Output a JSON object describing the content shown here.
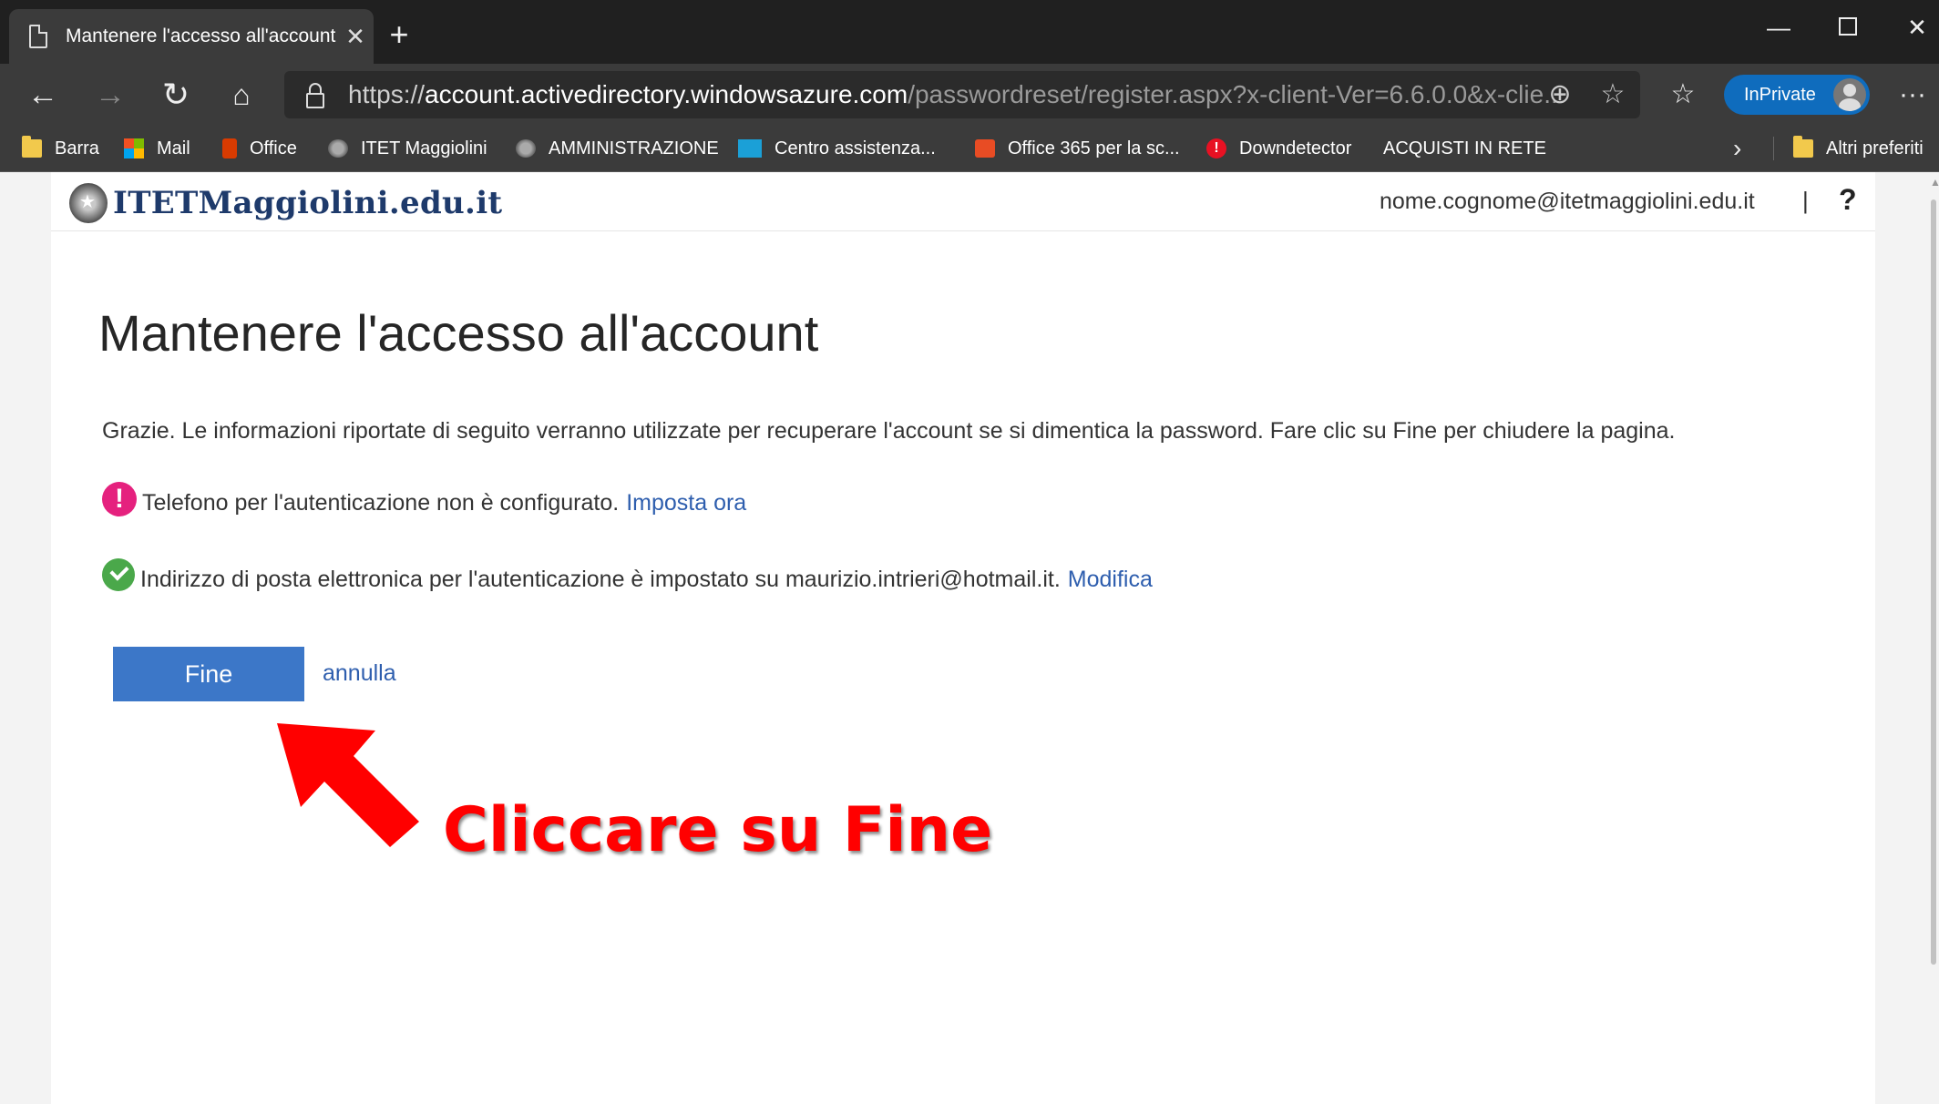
{
  "browser": {
    "tab_title": "Mantenere l'accesso all'account",
    "tab_close": "✕",
    "new_tab": "+",
    "url_scheme": "https://",
    "url_host": "account.activedirectory.windowsazure.com",
    "url_path": "/passwordreset/register.aspx?x-client-Ver=6.6.0.0&x-clie...",
    "inprivate_label": "InPrivate",
    "more": "···"
  },
  "favorites": [
    {
      "label": "Barra",
      "icon": "folder-icon"
    },
    {
      "label": "Mail",
      "icon": "microsoft-icon"
    },
    {
      "label": "Office",
      "icon": "office-icon"
    },
    {
      "label": "ITET Maggiolini",
      "icon": "emblem-icon"
    },
    {
      "label": "AMMINISTRAZIONE",
      "icon": "emblem-icon"
    },
    {
      "label": "Centro assistenza...",
      "icon": "cisco-icon"
    },
    {
      "label": "Office 365 per la sc...",
      "icon": "office365-icon"
    },
    {
      "label": "Downdetector",
      "icon": "downdetector-icon"
    },
    {
      "label": "ACQUISTI IN RETE",
      "icon": "page-icon"
    },
    {
      "label": "Altri preferiti",
      "icon": "folder-icon"
    }
  ],
  "page": {
    "logo_text": "ITETMaggiolini.edu.it",
    "user_email": "nome.cognome@itetmaggiolini.edu.it",
    "separator": "|",
    "help": "?",
    "title": "Mantenere l'accesso all'account",
    "description": "Grazie. Le informazioni riportate di seguito verranno utilizzate per recuperare l'account se si dimentica la password. Fare clic su Fine per chiudere la pagina.",
    "phone_status_text": "Telefono per l'autenticazione non è configurato.",
    "phone_action": "Imposta ora",
    "email_status_text": "Indirizzo di posta elettronica per l'autenticazione è impostato su maurizio.intrieri@hotmail.it.",
    "email_action": "Modifica",
    "finish_button": "Fine",
    "cancel_link": "annulla",
    "warning_glyph": "!"
  },
  "annotation": {
    "text": "Cliccare su Fine",
    "color": "#ff0000"
  }
}
